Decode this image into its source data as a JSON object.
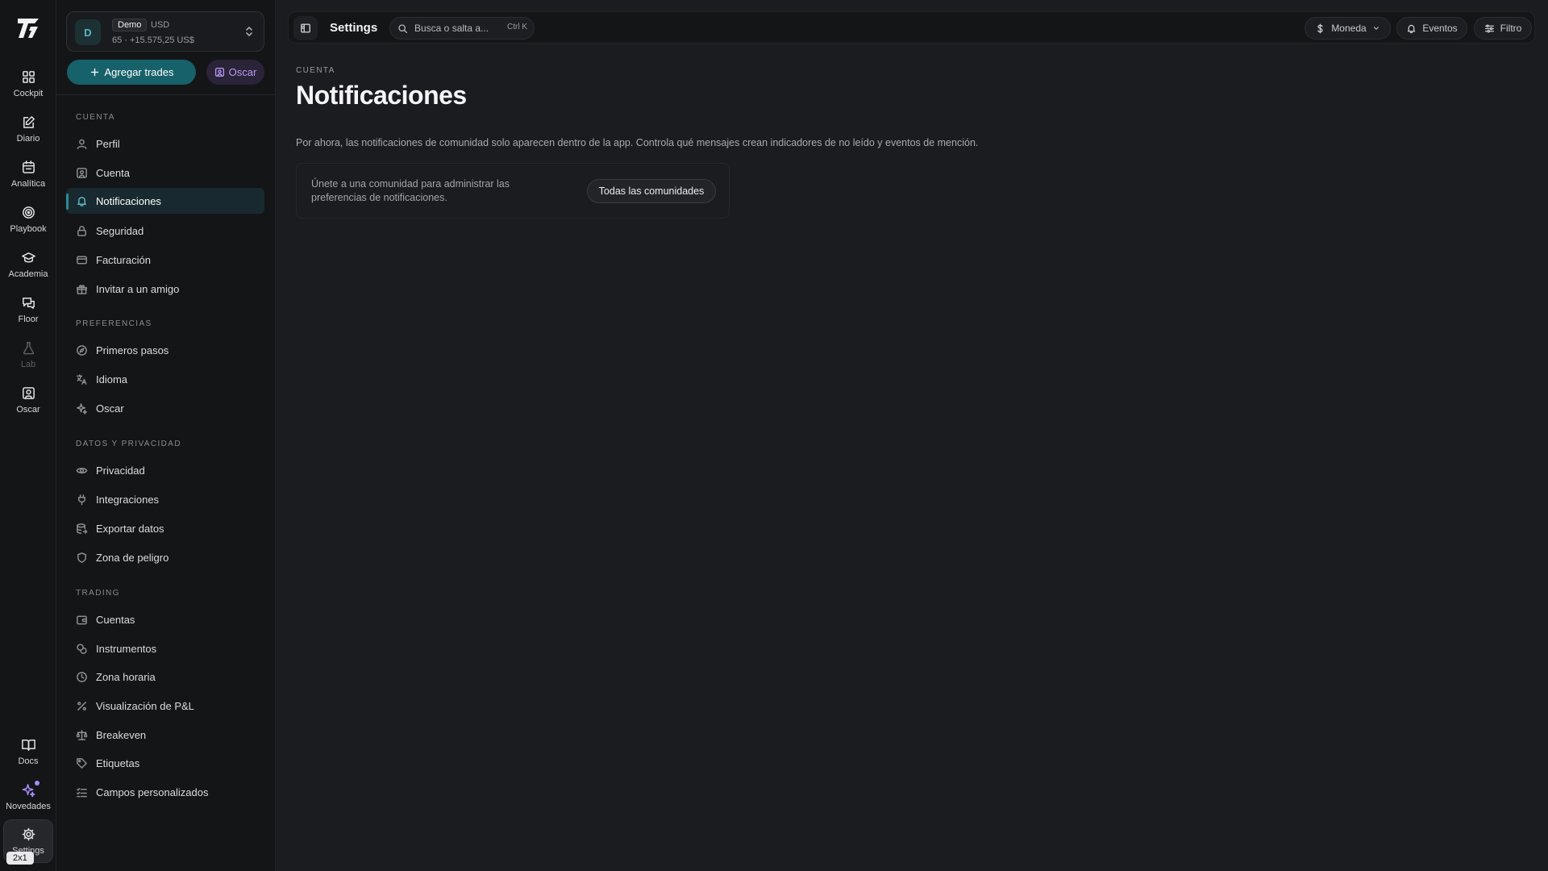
{
  "rail": {
    "items": [
      {
        "label": "Cockpit"
      },
      {
        "label": "Diario"
      },
      {
        "label": "Analítica"
      },
      {
        "label": "Playbook"
      },
      {
        "label": "Academia"
      },
      {
        "label": "Floor"
      },
      {
        "label": "Lab"
      },
      {
        "label": "Oscar"
      }
    ],
    "bottom": [
      {
        "label": "Docs"
      },
      {
        "label": "Novedades"
      },
      {
        "label": "Settings"
      }
    ],
    "badge": "2x1"
  },
  "account": {
    "avatar_letter": "D",
    "tag": "Demo",
    "currency": "USD",
    "summary": "65 · +15.575,25 US$"
  },
  "actions": {
    "add_trades": "Agregar trades",
    "oscar": "Oscar"
  },
  "sidebar": {
    "sections": [
      {
        "title": "Cuenta",
        "items": [
          {
            "label": "Perfil"
          },
          {
            "label": "Cuenta"
          },
          {
            "label": "Notificaciones"
          },
          {
            "label": "Seguridad"
          },
          {
            "label": "Facturación"
          },
          {
            "label": "Invitar a un amigo"
          }
        ]
      },
      {
        "title": "Preferencias",
        "items": [
          {
            "label": "Primeros pasos"
          },
          {
            "label": "Idioma"
          },
          {
            "label": "Oscar"
          }
        ]
      },
      {
        "title": "Datos y privacidad",
        "items": [
          {
            "label": "Privacidad"
          },
          {
            "label": "Integraciones"
          },
          {
            "label": "Exportar datos"
          },
          {
            "label": "Zona de peligro"
          }
        ]
      },
      {
        "title": "Trading",
        "items": [
          {
            "label": "Cuentas"
          },
          {
            "label": "Instrumentos"
          },
          {
            "label": "Zona horaria"
          },
          {
            "label": "Visualización de P&L"
          },
          {
            "label": "Breakeven"
          },
          {
            "label": "Etiquetas"
          },
          {
            "label": "Campos personalizados"
          }
        ]
      }
    ]
  },
  "topbar": {
    "title": "Settings",
    "search_placeholder": "Busca o salta a...",
    "shortcut": "Ctrl K",
    "currency_label": "Moneda",
    "events_label": "Eventos",
    "filter_label": "Filtro"
  },
  "main": {
    "eyebrow": "Cuenta",
    "title": "Notificaciones",
    "description": "Por ahora, las notificaciones de comunidad solo aparecen dentro de la app. Controla qué mensajes crean indicadores de no leído y eventos de mención.",
    "card_text": "Únete a una comunidad para administrar las preferencias de notificaciones.",
    "card_button": "Todas las comunidades"
  },
  "colors": {
    "accent": "#17616a",
    "accent_active_bg": "#182a2f",
    "oscar_purple": "#b89af5",
    "background": "#1b1c1f"
  }
}
